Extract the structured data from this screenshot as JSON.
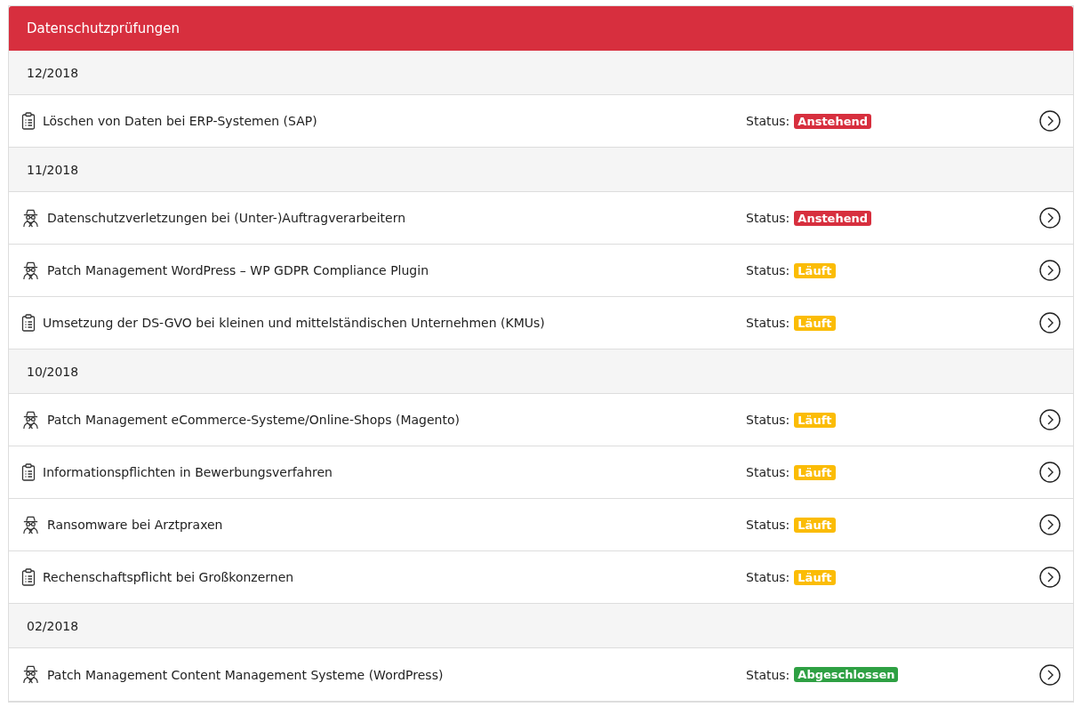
{
  "panel": {
    "title": "Datenschutzprüfungen"
  },
  "groups": [
    {
      "label": "12/2018",
      "items": [
        {
          "kind": "checklist",
          "title": "Löschen von Daten bei ERP-Systemen (SAP)",
          "status_label": "Status:",
          "status": "Anstehend",
          "color": "#d72f3e"
        }
      ]
    },
    {
      "label": "11/2018",
      "items": [
        {
          "kind": "spy",
          "title": "Datenschutzverletzungen bei (Unter-)Auftragverarbeitern",
          "status_label": "Status:",
          "status": "Anstehend",
          "color": "#d72f3e"
        },
        {
          "kind": "spy",
          "title": "Patch Management WordPress – WP GDPR Compliance Plugin",
          "status_label": "Status:",
          "status": "Läuft",
          "color": "#fbbc05"
        },
        {
          "kind": "checklist",
          "title": "Umsetzung der DS-GVO bei kleinen und mittelständischen Unternehmen (KMUs)",
          "status_label": "Status:",
          "status": "Läuft",
          "color": "#fbbc05"
        }
      ]
    },
    {
      "label": "10/2018",
      "items": [
        {
          "kind": "spy",
          "title": "Patch Management eCommerce-Systeme/Online-Shops (Magento)",
          "status_label": "Status:",
          "status": "Läuft",
          "color": "#fbbc05"
        },
        {
          "kind": "checklist",
          "title": "Informationspflichten in Bewerbungsverfahren",
          "status_label": "Status:",
          "status": "Läuft",
          "color": "#fbbc05"
        },
        {
          "kind": "spy",
          "title": "Ransomware bei Arztpraxen",
          "status_label": "Status:",
          "status": "Läuft",
          "color": "#fbbc05"
        },
        {
          "kind": "checklist",
          "title": "Rechenschaftspflicht bei Großkonzernen",
          "status_label": "Status:",
          "status": "Läuft",
          "color": "#fbbc05"
        }
      ]
    },
    {
      "label": "02/2018",
      "items": [
        {
          "kind": "spy",
          "title": "Patch Management Content Management Systeme (WordPress)",
          "status_label": "Status:",
          "status": "Abgeschlossen",
          "color": "#2ea043"
        }
      ]
    }
  ]
}
